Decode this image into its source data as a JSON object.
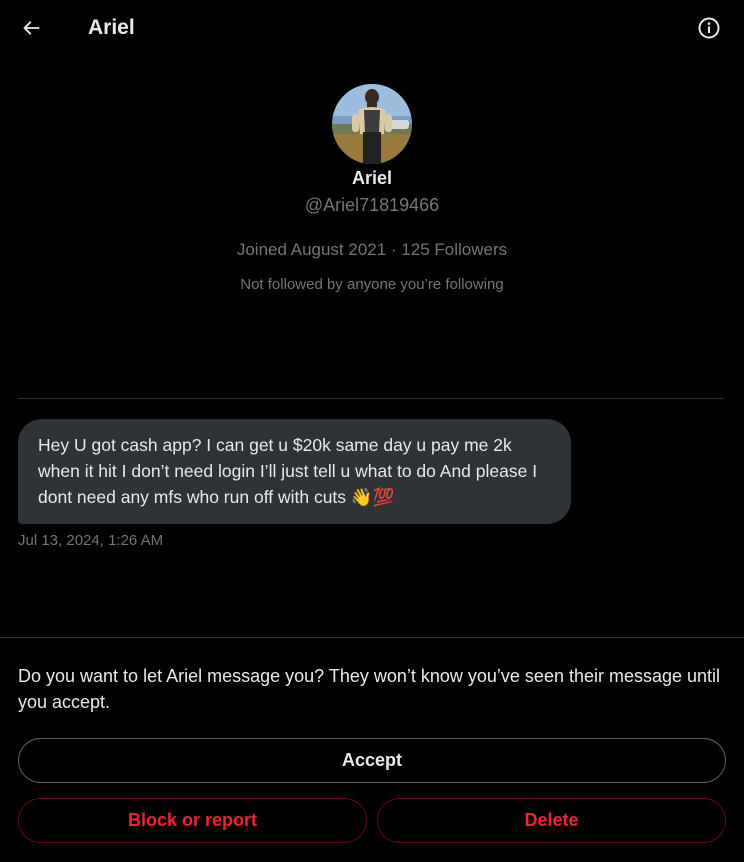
{
  "header": {
    "title": "Ariel",
    "back_icon": "arrow-left-icon",
    "info_icon": "info-icon"
  },
  "profile": {
    "name": "Ariel",
    "handle": "@Ariel71819466",
    "meta": "Joined August 2021 · 125 Followers",
    "followed_note": "Not followed by anyone you’re following"
  },
  "message": {
    "text": "Hey U got cash app? I can get u $20k same day u pay me 2k when it hit I don’t need login I’ll just tell u what to do And please I dont need any mfs who run off with cuts 👋💯",
    "timestamp": "Jul 13, 2024, 1:26 AM"
  },
  "request": {
    "prompt": "Do you want to let Ariel message you? They won’t know you’ve seen their message until you accept.",
    "accept_label": "Accept",
    "block_label": "Block or report",
    "delete_label": "Delete"
  },
  "colors": {
    "background": "#000000",
    "primary_text": "#e7e9ea",
    "secondary_text": "#71767b",
    "bubble": "#2f3336",
    "danger": "#f4212e"
  }
}
